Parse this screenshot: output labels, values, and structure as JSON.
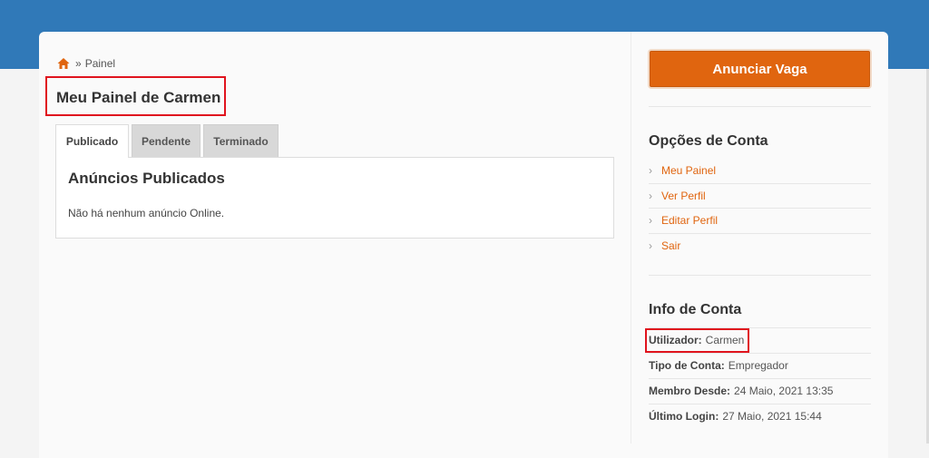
{
  "breadcrumb": {
    "separator": "»",
    "current": "Painel"
  },
  "page": {
    "title": "Meu Painel de Carmen"
  },
  "tabs": [
    {
      "label": "Publicado",
      "active": true
    },
    {
      "label": "Pendente",
      "active": false
    },
    {
      "label": "Terminado",
      "active": false
    }
  ],
  "panel": {
    "title": "Anúncios Publicados",
    "empty_text": "Não há nenhum anúncio Online."
  },
  "sidebar": {
    "post_job_label": "Anunciar Vaga",
    "account_options": {
      "title": "Opções de Conta",
      "links": [
        "Meu Painel",
        "Ver Perfil",
        "Editar Perfil",
        "Sair"
      ]
    },
    "account_info": {
      "title": "Info de Conta",
      "rows": [
        {
          "label": "Utilizador:",
          "value": "Carmen"
        },
        {
          "label": "Tipo de Conta:",
          "value": "Empregador"
        },
        {
          "label": "Membro Desde:",
          "value": "24 Maio, 2021 13:35"
        },
        {
          "label": "Último Login:",
          "value": "27 Maio, 2021 15:44"
        }
      ]
    }
  },
  "colors": {
    "header_blue": "#3079b8",
    "accent_orange": "#e0650f",
    "highlight_red": "#e0141e"
  },
  "icons": {
    "home": "home-icon",
    "link_bullet": "chevron-right-icon"
  }
}
